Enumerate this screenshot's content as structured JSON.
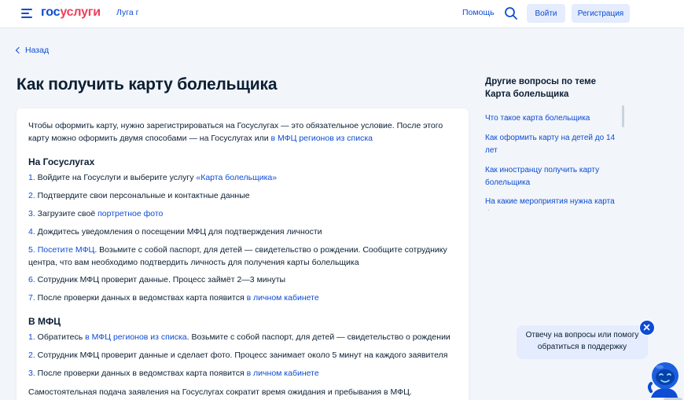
{
  "header": {
    "logo_gos": "гос",
    "logo_uslugi": "услуги",
    "city": "Луга г",
    "help": "Помощь",
    "login": "Войти",
    "register": "Регистрация"
  },
  "back": "Назад",
  "title": "Как получить карту болельщика",
  "intro": {
    "text": "Чтобы оформить карту, нужно зарегистрироваться на Госуслугах — это обязательное условие. После этого карту можно оформить двумя способами — на Госуслугах или ",
    "link": "в МФЦ регионов из списка"
  },
  "section1": {
    "title": "На Госуслугах",
    "steps": [
      {
        "num": "1.",
        "text": " Войдите на Госуслуги и выберите услугу ",
        "link": "«Карта болельщика»",
        "after": ""
      },
      {
        "num": "2.",
        "text": " Подтвердите свои персональные и контактные данные",
        "link": "",
        "after": ""
      },
      {
        "num": "3.",
        "text": " Загрузите своё ",
        "link": "портретное фото",
        "after": ""
      },
      {
        "num": "4.",
        "text": " Дождитесь уведомления о посещении МФЦ для подтверждения личности",
        "link": "",
        "after": ""
      },
      {
        "num": "5.",
        "text": " ",
        "link": "Посетите МФЦ",
        "after": ". Возьмите с собой паспорт, для детей — свидетельство о рождении. Сообщите сотруднику центра, что вам необходимо подтвердить личность для получения карты болельщика"
      },
      {
        "num": "6.",
        "text": " Сотрудник МФЦ проверит данные. Процесс займёт 2—3 минуты",
        "link": "",
        "after": ""
      },
      {
        "num": "7.",
        "text": " После проверки данных в ведомствах карта появится ",
        "link": "в личном кабинете",
        "after": ""
      }
    ]
  },
  "section2": {
    "title": "В МФЦ",
    "steps": [
      {
        "num": "1.",
        "text": " Обратитесь ",
        "link": "в МФЦ регионов из списка",
        "after": ". Возьмите с собой паспорт, для детей — свидетельство о рождении"
      },
      {
        "num": "2.",
        "text": " Сотрудник МФЦ проверит данные и сделает фото. Процесс занимает около 5 минут на каждого заявителя",
        "link": "",
        "after": ""
      },
      {
        "num": "3.",
        "text": " После проверки данных в ведомствах карта появится ",
        "link": "в личном кабинете",
        "after": ""
      }
    ]
  },
  "bottom_text": "Самостоятельная подача заявления на Госуслугах сократит время ожидания и пребывания в МФЦ. Спланируйте",
  "sidebar": {
    "title": "Другие вопросы по теме Карта болельщика",
    "items": [
      "Что такое карта болельщика",
      "Как оформить карту на детей до 14 лет",
      "Как иностранцу получить карту болельщика",
      "На какие мероприятия нужна карта болельщика"
    ]
  },
  "chat": {
    "bubble": "Отвечу на вопросы или помогу обратиться в поддержку"
  },
  "colors": {
    "accent": "#0d4cd3",
    "logo_red": "#ee3f58",
    "background": "#f2f5fa",
    "button_bg": "#e4ecfd"
  },
  "icons": [
    "burger-menu-icon",
    "search-icon",
    "chevron-left-icon",
    "close-icon",
    "robot-assistant-icon"
  ]
}
